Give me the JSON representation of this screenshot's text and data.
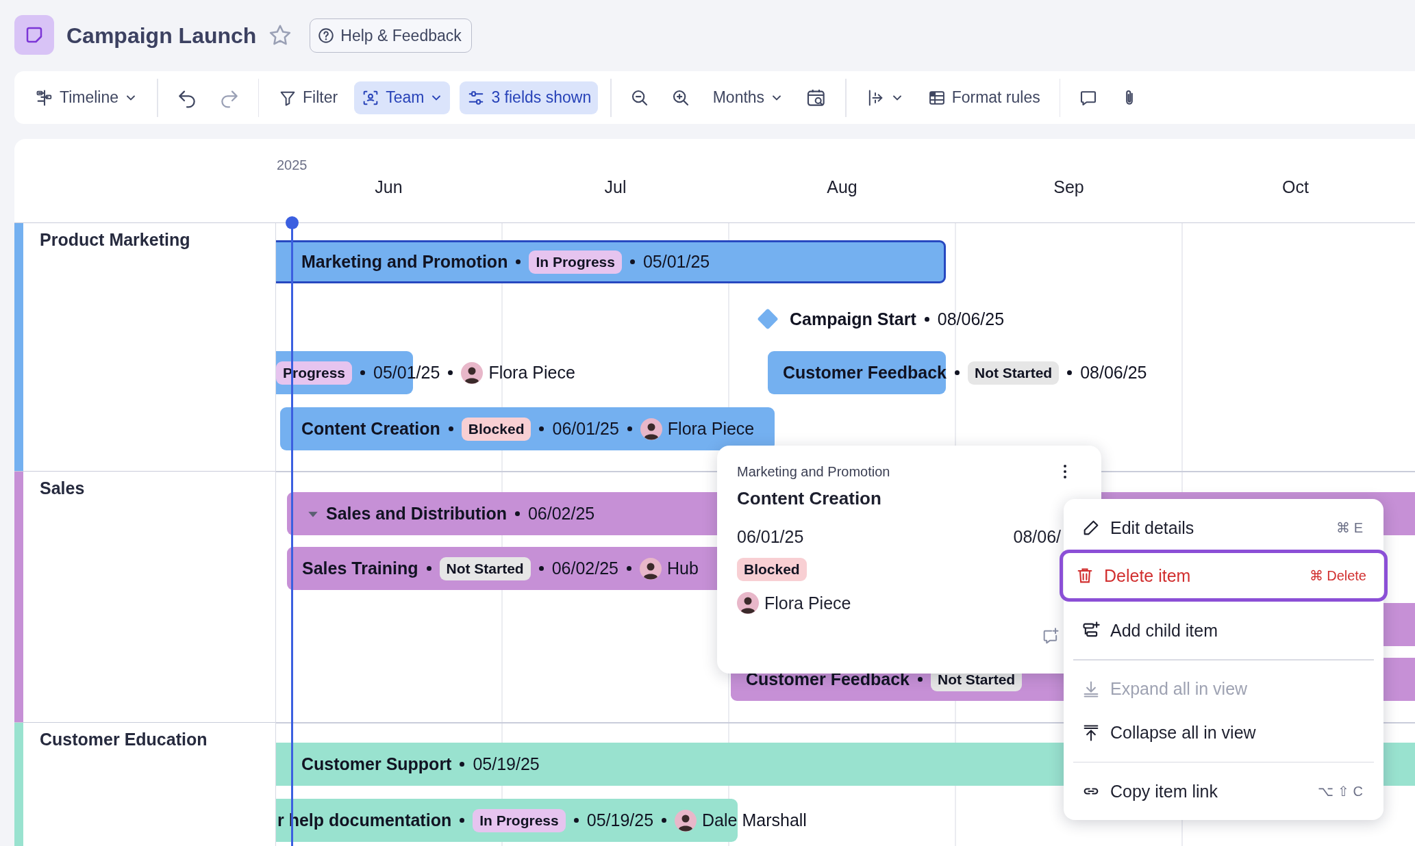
{
  "app": {
    "title": "Campaign Launch",
    "help": "Help & Feedback"
  },
  "toolbar": {
    "view": "Timeline",
    "filter": {
      "label": "Filter",
      "selected": false
    },
    "team": {
      "label": "Team",
      "selected": true
    },
    "fields": {
      "label": "3 fields shown",
      "selected": true
    },
    "scale": "Months",
    "format": "Format rules"
  },
  "timeline": {
    "year": "2025",
    "months": [
      "Jun",
      "Jul",
      "Aug",
      "Sep",
      "Oct"
    ],
    "groups": [
      {
        "name": "Product Marketing",
        "color": "#74b0f0",
        "items": [
          {
            "kind": "bar",
            "title": "Marketing and Promotion",
            "status": {
              "label": "In Progress",
              "color": "#e6c4ef"
            },
            "date": "05/01/25",
            "selected": true
          },
          {
            "kind": "milestone",
            "title": "Campaign Start",
            "date": "08/06/25"
          },
          {
            "kind": "bar",
            "status": {
              "label": "Progress",
              "color": "#e6c4ef"
            },
            "date": "05/01/25",
            "assignee": "Flora Piece",
            "selected": false
          },
          {
            "kind": "bar",
            "title": "Customer Feedback",
            "status": {
              "label": "Not Started",
              "color": "#e6e6e6"
            },
            "date": "08/06/25",
            "selected": false
          },
          {
            "kind": "bar",
            "title": "Content Creation",
            "status": {
              "label": "Blocked",
              "color": "#f8cfd3"
            },
            "date": "06/01/25",
            "assignee": "Flora Piece",
            "selected": false
          }
        ]
      },
      {
        "name": "Sales",
        "color": "#c690d6",
        "items": [
          {
            "kind": "bar",
            "title": "Sales and Distribution",
            "date": "06/02/25",
            "expanded": true,
            "selected": false
          },
          {
            "kind": "bar",
            "title": "Sales Training",
            "status": {
              "label": "Not Started",
              "color": "#e6e6e6"
            },
            "date": "06/02/25",
            "assignee": "Hub",
            "selected": false
          },
          {
            "kind": "bar",
            "selected": false
          },
          {
            "kind": "bar",
            "title": "Customer Feedback",
            "status": {
              "label": "Not Started",
              "color": "#e6e6e6"
            },
            "selected": false
          }
        ]
      },
      {
        "name": "Customer Education",
        "color": "#99e2cf",
        "items": [
          {
            "kind": "bar",
            "title": "Customer Support",
            "date": "05/19/25",
            "selected": false
          },
          {
            "kind": "bar",
            "title": "r help documentation",
            "status": {
              "label": "In Progress",
              "color": "#e6c4ef"
            },
            "date": "05/19/25",
            "assignee": "Dale Marshall",
            "selected": false
          }
        ]
      }
    ]
  },
  "popup": {
    "parent": "Marketing and Promotion",
    "title": "Content Creation",
    "start": "06/01/25",
    "end": "08/06/",
    "status": {
      "label": "Blocked",
      "color": "#f8cfd3"
    },
    "assignee": "Flora Piece"
  },
  "menu": {
    "sections": [
      [
        {
          "kind": "edit",
          "label": "Edit details",
          "shortcut": "⌘ E",
          "danger": false,
          "disabled": false,
          "selected": false
        },
        {
          "kind": "delete",
          "label": "Delete item",
          "shortcut": "⌘ Delete",
          "danger": true,
          "disabled": false,
          "selected": true
        },
        {
          "kind": "child",
          "label": "Add child item",
          "danger": false,
          "disabled": false,
          "selected": false
        }
      ],
      [
        {
          "kind": "expand",
          "label": "Expand all in view",
          "danger": false,
          "disabled": true,
          "selected": false
        },
        {
          "kind": "collapse",
          "label": "Collapse all in view",
          "danger": false,
          "disabled": false,
          "selected": false
        }
      ],
      [
        {
          "kind": "link",
          "label": "Copy item link",
          "shortcut": "⌥ ⇧ C",
          "danger": false,
          "disabled": false,
          "selected": false
        }
      ]
    ]
  }
}
